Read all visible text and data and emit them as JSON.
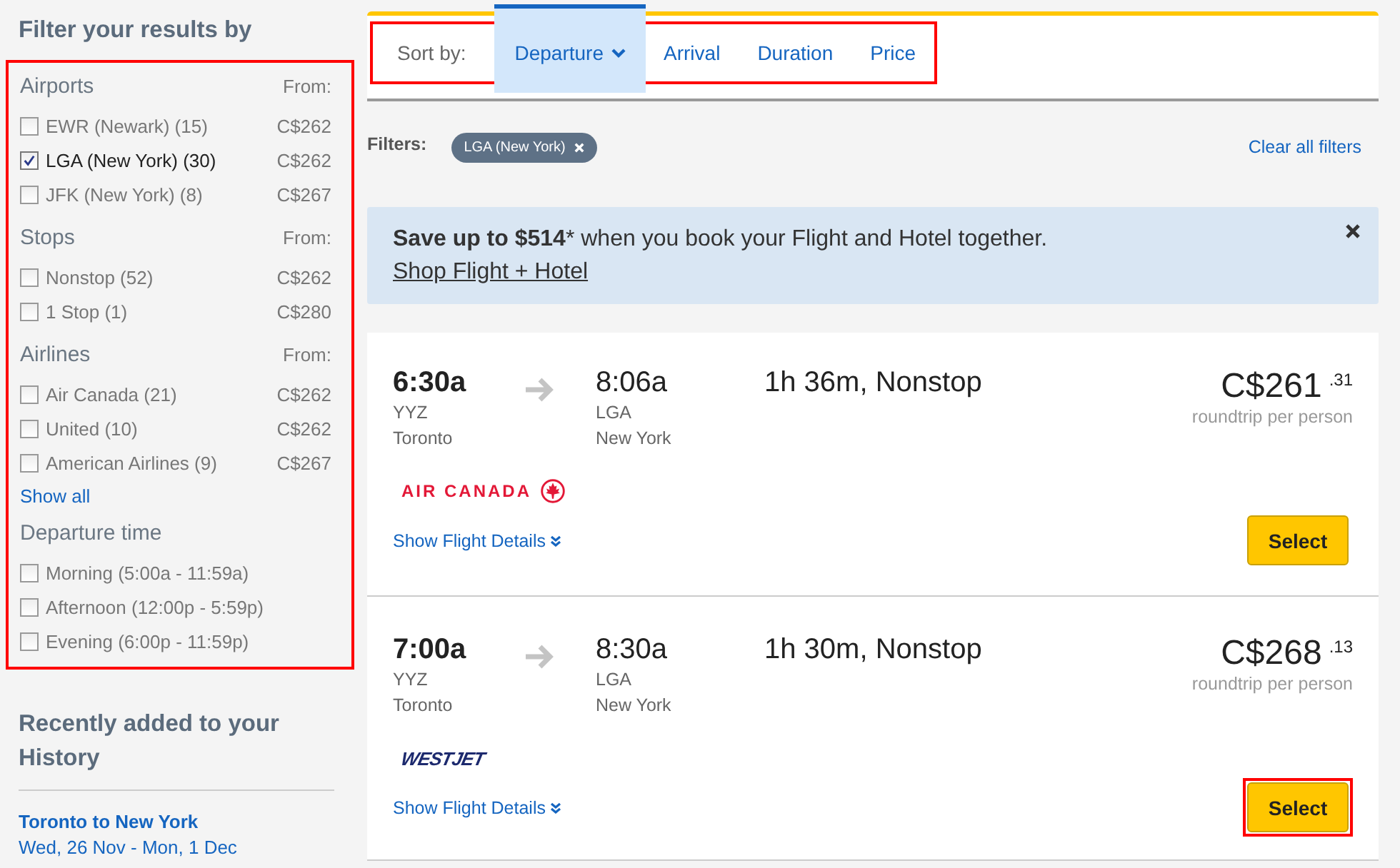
{
  "sidebar": {
    "title": "Filter your results by",
    "highlighted": true,
    "groups": [
      {
        "heading": "Airports",
        "from_label": "From:",
        "items": [
          {
            "label": "EWR (Newark) (15)",
            "price": "C$262",
            "checked": false
          },
          {
            "label": "LGA (New York) (30)",
            "price": "C$262",
            "checked": true
          },
          {
            "label": "JFK (New York) (8)",
            "price": "C$267",
            "checked": false
          }
        ]
      },
      {
        "heading": "Stops",
        "from_label": "From:",
        "items": [
          {
            "label": "Nonstop (52)",
            "price": "C$262",
            "checked": false
          },
          {
            "label": "1 Stop (1)",
            "price": "C$280",
            "checked": false
          }
        ]
      },
      {
        "heading": "Airlines",
        "from_label": "From:",
        "items": [
          {
            "label": "Air Canada (21)",
            "price": "C$262",
            "checked": false
          },
          {
            "label": "United (10)",
            "price": "C$262",
            "checked": false
          },
          {
            "label": "American Airlines (9)",
            "price": "C$267",
            "checked": false
          }
        ],
        "link": "Show all"
      },
      {
        "heading": "Departure time",
        "items": [
          {
            "label": "Morning (5:00a - 11:59a)",
            "checked": false
          },
          {
            "label": "Afternoon (12:00p - 5:59p)",
            "checked": false
          },
          {
            "label": "Evening (6:00p - 11:59p)",
            "checked": false
          }
        ]
      }
    ],
    "history": {
      "title": "Recently added to your History",
      "route": "Toronto to New York",
      "dates": "Wed, 26 Nov - Mon, 1 Dec"
    }
  },
  "sort": {
    "label": "Sort by:",
    "highlighted": true,
    "options": [
      {
        "label": "Departure",
        "selected": true
      },
      {
        "label": "Arrival",
        "selected": false
      },
      {
        "label": "Duration",
        "selected": false
      },
      {
        "label": "Price",
        "selected": false
      }
    ]
  },
  "filters": {
    "label": "Filters:",
    "chips": [
      "LGA (New York)"
    ],
    "clear": "Clear all filters"
  },
  "promo": {
    "text": "**Save up to $514*** when you book your Flight and Hotel together.",
    "link": "Shop Flight + Hotel"
  },
  "flights": [
    {
      "depart_time": "6:30a",
      "depart_code": "YYZ",
      "depart_city": "Toronto",
      "arrive_time": "8:06a",
      "arrive_code": "LGA",
      "arrive_city": "New York",
      "duration": "1h 36m, Nonstop",
      "price": "C$261",
      "cents": ".31",
      "price_note": "roundtrip per person",
      "airline": "AIR CANADA",
      "kind": "aircanada",
      "details": "Show Flight Details",
      "button": "Select",
      "highlighted": false
    },
    {
      "depart_time": "7:00a",
      "depart_code": "YYZ",
      "depart_city": "Toronto",
      "arrive_time": "8:30a",
      "arrive_code": "LGA",
      "arrive_city": "New York",
      "duration": "1h 30m, Nonstop",
      "price": "C$268",
      "cents": ".13",
      "price_note": "roundtrip per person",
      "airline": "WESTJET",
      "kind": "westjet",
      "details": "Show Flight Details",
      "button": "Select",
      "highlighted": true
    }
  ]
}
